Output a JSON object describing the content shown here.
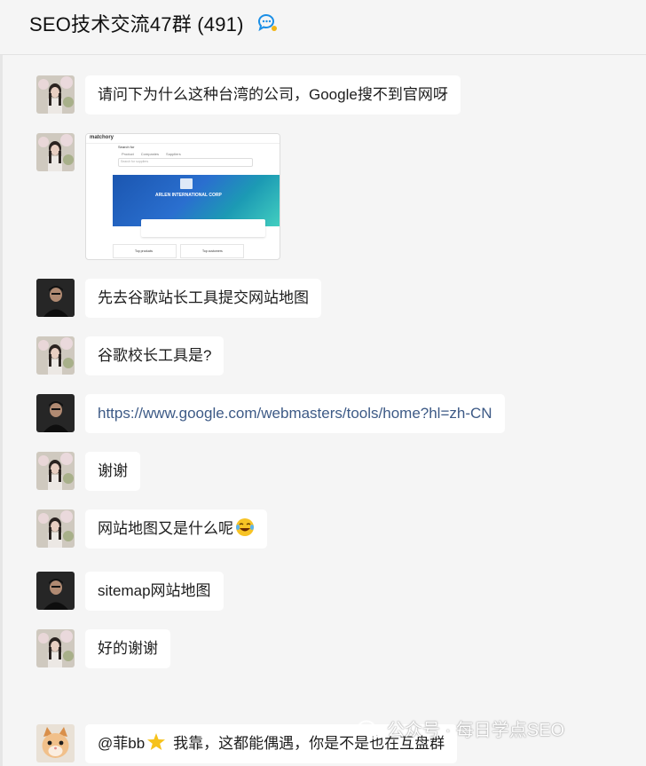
{
  "header": {
    "title": "SEO技术交流47群 (491)"
  },
  "messages": [
    {
      "sender": "girl",
      "text": "请问下为什么这种台湾的公司，Google搜不到官网呀"
    },
    {
      "sender": "girl",
      "type": "image",
      "image": {
        "logo": "matchory",
        "section_label": "Search for",
        "tabs": [
          "Product",
          "Companies",
          "Suppliers"
        ],
        "search_placeholder": "Search for suppliers",
        "company": "ARLEN INTERNATIONAL CORP",
        "cards": [
          "Top products",
          "Top customers"
        ]
      }
    },
    {
      "sender": "man",
      "text": "先去谷歌站长工具提交网站地图"
    },
    {
      "sender": "girl",
      "text": "谷歌校长工具是?"
    },
    {
      "sender": "man",
      "text": "https://www.google.com/webmasters/tools/home?hl=zh-CN",
      "is_link": true
    },
    {
      "sender": "girl",
      "text": "谢谢"
    },
    {
      "sender": "girl",
      "text": "网站地图又是什么呢",
      "emoji": "laughing-tears"
    },
    {
      "sender": "man",
      "text": "sitemap网站地图"
    },
    {
      "sender": "girl",
      "text": "好的谢谢"
    },
    {
      "sender": "cat",
      "text": "@菲bb",
      "text2": "我靠，这都能偶遇，你是不是也在互盘群",
      "emoji": "star"
    }
  ],
  "watermark": {
    "text": "公众号 · 每日学点SEO"
  }
}
